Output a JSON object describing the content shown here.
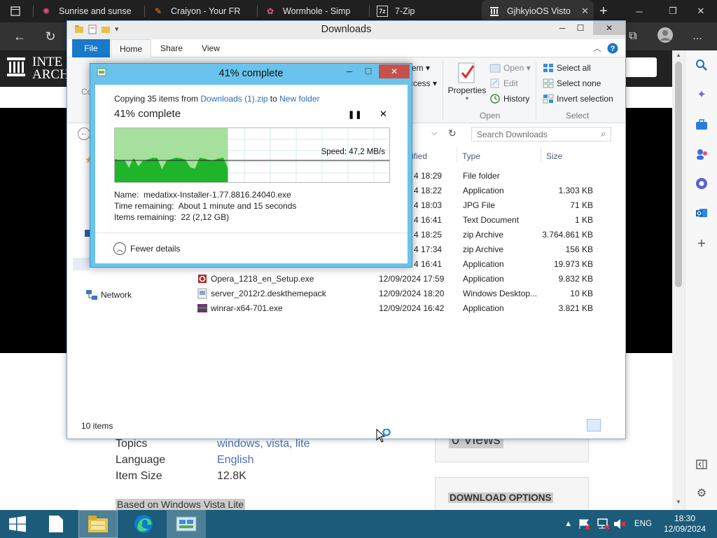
{
  "browser": {
    "tabs": [
      {
        "title": "Sunrise and sunse",
        "icon": "sun-favicon",
        "color": "#e8537a"
      },
      {
        "title": "Craiyon - Your FR",
        "icon": "pencil-favicon",
        "color": "#f28b2f"
      },
      {
        "title": "Wormhole - Simp",
        "icon": "wormhole-favicon",
        "color": "#e25c8c"
      },
      {
        "title": "7-Zip",
        "icon": "7zip-favicon",
        "color": "#ffffff"
      },
      {
        "title": "GjhkyioOS Visto",
        "icon": "archive-favicon",
        "color": "#ffffff"
      }
    ],
    "new_tab": "+",
    "more": "..."
  },
  "webpage": {
    "logo_line1": "INTE",
    "logo_line2": "ARCH",
    "metadata": [
      {
        "key": "Topics",
        "value": "windows, vista, lite"
      },
      {
        "key": "Language",
        "value": "English"
      },
      {
        "key": "Item Size",
        "value": "12.8K"
      }
    ],
    "based_on": "Based on Windows Vista Lite",
    "views": "0 Views",
    "download_options": "DOWNLOAD OPTIONS"
  },
  "explorer": {
    "title": "Downloads",
    "ribbon_tabs": [
      "File",
      "Home",
      "Share",
      "View"
    ],
    "ribbon_left_partial": "Co",
    "ribbon": {
      "new_item_partial": "em",
      "easy_access_partial": "ccess",
      "properties": "Properties",
      "open": "Open",
      "edit": "Edit",
      "history": "History",
      "select_all": "Select all",
      "select_none": "Select none",
      "invert_selection": "Invert selection",
      "group_open": "Open",
      "group_select": "Select"
    },
    "search_placeholder": "Search Downloads",
    "columns": {
      "modified_partial": "ified",
      "type": "Type",
      "size": "Size"
    },
    "files": [
      {
        "name": "",
        "date": "4 18:29",
        "type": "File folder",
        "size": ""
      },
      {
        "name": "",
        "date": "4 18:22",
        "type": "Application",
        "size": "1.303 KB"
      },
      {
        "name": "",
        "date": "4 18:03",
        "type": "JPG File",
        "size": "71 KB"
      },
      {
        "name": "",
        "date": "4 16:41",
        "type": "Text Document",
        "size": "1 KB"
      },
      {
        "name": "",
        "date": "4 18:25",
        "type": "zip Archive",
        "size": "3.764.861 KB"
      },
      {
        "name": "",
        "date": "4 17:34",
        "type": "zip Archive",
        "size": "156 KB"
      },
      {
        "name": "",
        "date": "4 16:41",
        "type": "Application",
        "size": "19.973 KB"
      },
      {
        "name": "Opera_1218_en_Setup.exe",
        "date": "12/09/2024 17:59",
        "type": "Application",
        "size": "9.832 KB"
      },
      {
        "name": "server_2012r2.deskthemepack",
        "date": "12/09/2024 18:20",
        "type": "Windows Desktop...",
        "size": "10 KB"
      },
      {
        "name": "winrar-x64-701.exe",
        "date": "12/09/2024 16:42",
        "type": "Application",
        "size": "3.821 KB"
      }
    ],
    "nav_network": "Network",
    "status": "10 items"
  },
  "copy_dialog": {
    "title": "41% complete",
    "copying_prefix": "Copying 35 items from ",
    "source": "Downloads (1).zip",
    "to": " to ",
    "destination": "New folder",
    "percent_text": "41% complete",
    "progress": 0.41,
    "speed": "Speed: 47,2 MB/s",
    "name_label": "Name:",
    "name_value": "medatixx-Installer-1.77.8816.24040.exe",
    "time_label": "Time remaining:",
    "time_value": "About 1 minute and 15 seconds",
    "items_label": "Items remaining:",
    "items_value": "22 (2,12 GB)",
    "fewer_details": "Fewer details"
  },
  "taskbar": {
    "language": "ENG",
    "time": "18:30",
    "date": "12/09/2024"
  },
  "colors": {
    "taskbar": "#1c5b79",
    "dialog_frame": "#69c3ed",
    "progress_fill": "#a6e09d",
    "speed_fill": "#1fb52a",
    "link": "#2a6eb8"
  }
}
